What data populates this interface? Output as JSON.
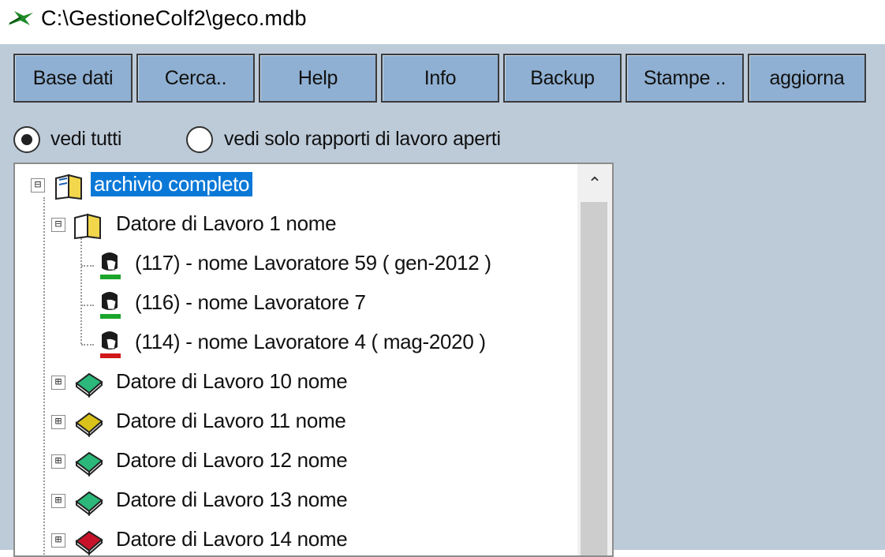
{
  "window": {
    "title": "C:\\GestioneColf2\\geco.mdb"
  },
  "toolbar": {
    "buttons": [
      {
        "label": "Base dati"
      },
      {
        "label": "Cerca.."
      },
      {
        "label": "Help"
      },
      {
        "label": "Info"
      },
      {
        "label": "Backup"
      },
      {
        "label": "Stampe .."
      },
      {
        "label": "aggiorna"
      }
    ]
  },
  "filter": {
    "options": [
      {
        "label": "vedi tutti",
        "checked": true
      },
      {
        "label": "vedi solo rapporti di lavoro aperti",
        "checked": false
      }
    ]
  },
  "tree": {
    "root": {
      "label": "archivio completo",
      "expander": "⊟",
      "icon": "open-book-icon"
    },
    "expanded_employer": {
      "label": "Datore di Lavoro 1 nome",
      "expander": "⊟",
      "icon": "open-book-icon",
      "workers": [
        {
          "label": "(117) - nome Lavoratore 59 ( gen-2012 )",
          "status_color": "#1aa52b",
          "icon": "worker-icon"
        },
        {
          "label": "(116) - nome Lavoratore 7",
          "status_color": "#1aa52b",
          "icon": "worker-icon"
        },
        {
          "label": "(114) - nome Lavoratore 4 ( mag-2020 )",
          "status_color": "#d01818",
          "icon": "worker-icon"
        }
      ]
    },
    "employers": [
      {
        "label": "Datore di Lavoro 10 nome",
        "expander": "⊞",
        "book_color": "#2bb87a",
        "icon": "book-icon"
      },
      {
        "label": "Datore di Lavoro 11 nome",
        "expander": "⊞",
        "book_color": "#d9c21a",
        "icon": "book-icon"
      },
      {
        "label": "Datore di Lavoro 12 nome",
        "expander": "⊞",
        "book_color": "#2bb87a",
        "icon": "book-icon"
      },
      {
        "label": "Datore di Lavoro 13 nome",
        "expander": "⊞",
        "book_color": "#2bb87a",
        "icon": "book-icon"
      },
      {
        "label": "Datore di Lavoro 14 nome",
        "expander": "⊞",
        "book_color": "#c8122a",
        "icon": "book-icon"
      }
    ]
  },
  "scrollbar": {
    "up_arrow": "⌃"
  }
}
